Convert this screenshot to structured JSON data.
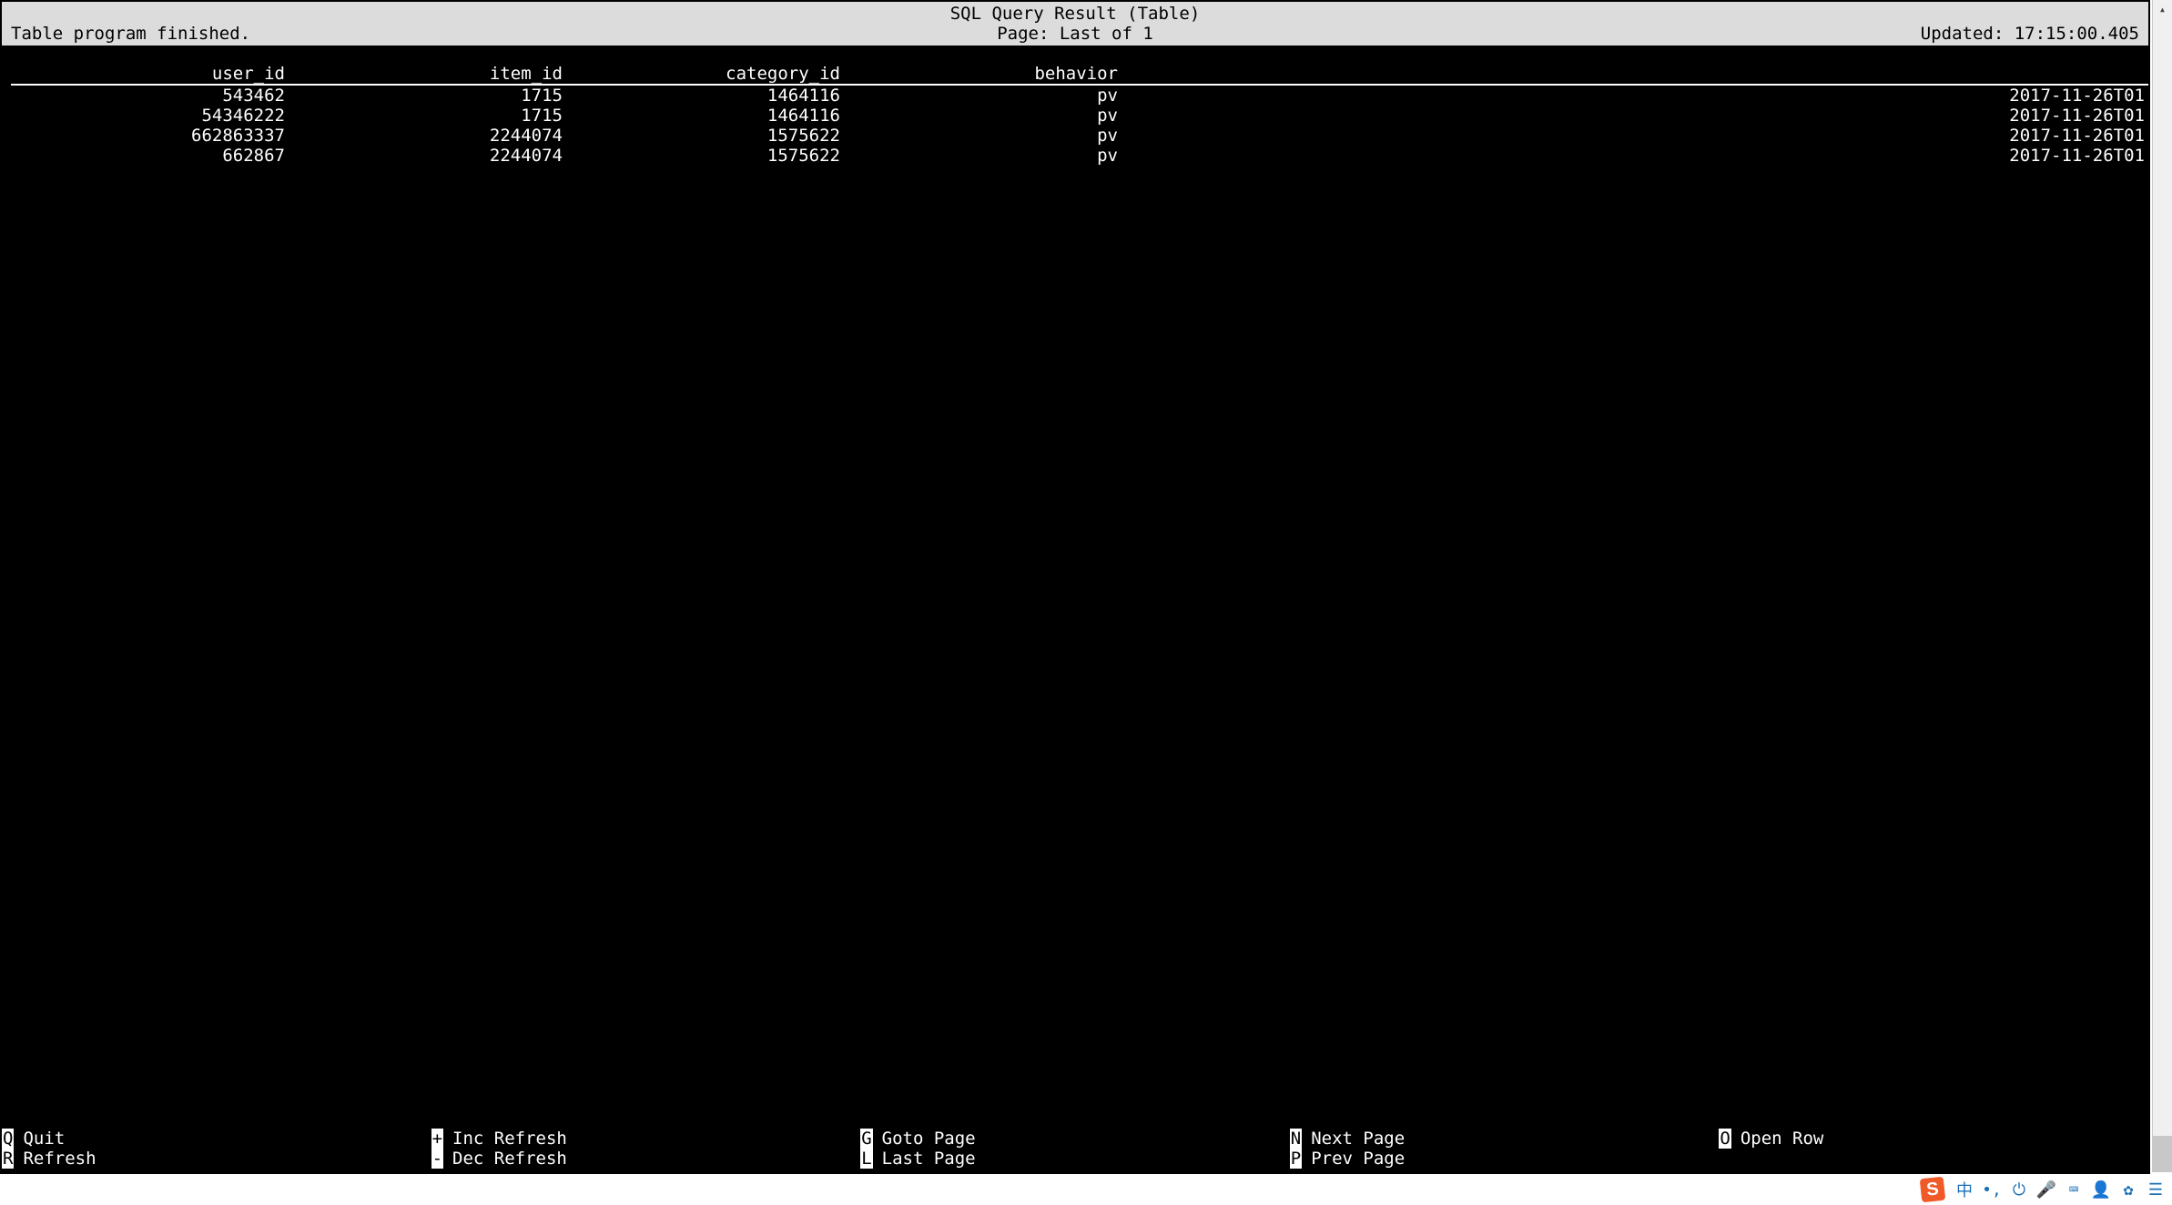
{
  "header": {
    "title": "SQL Query Result (Table)",
    "status_left": "Table program finished.",
    "page_info": "Page: Last of 1",
    "updated_label": "Updated:",
    "updated_time": "17:15:00.405"
  },
  "table": {
    "columns": [
      "user_id",
      "item_id",
      "category_id",
      "behavior",
      ""
    ],
    "rows": [
      {
        "user_id": "543462",
        "item_id": "1715",
        "category_id": "1464116",
        "behavior": "pv",
        "ts": "2017-11-26T01"
      },
      {
        "user_id": "54346222",
        "item_id": "1715",
        "category_id": "1464116",
        "behavior": "pv",
        "ts": "2017-11-26T01"
      },
      {
        "user_id": "662863337",
        "item_id": "2244074",
        "category_id": "1575622",
        "behavior": "pv",
        "ts": "2017-11-26T01"
      },
      {
        "user_id": "662867",
        "item_id": "2244074",
        "category_id": "1575622",
        "behavior": "pv",
        "ts": "2017-11-26T01"
      }
    ]
  },
  "footer": {
    "col1": [
      {
        "key": "Q",
        "label": "Quit"
      },
      {
        "key": "R",
        "label": "Refresh"
      }
    ],
    "col2": [
      {
        "key": "+",
        "label": "Inc Refresh"
      },
      {
        "key": "-",
        "label": "Dec Refresh"
      }
    ],
    "col3": [
      {
        "key": "G",
        "label": "Goto Page"
      },
      {
        "key": "L",
        "label": "Last Page"
      }
    ],
    "col4": [
      {
        "key": "N",
        "label": "Next Page"
      },
      {
        "key": "P",
        "label": "Prev Page"
      }
    ],
    "col5": [
      {
        "key": "O",
        "label": "Open Row"
      }
    ]
  },
  "taskbar": {
    "ime_badge": "S"
  }
}
